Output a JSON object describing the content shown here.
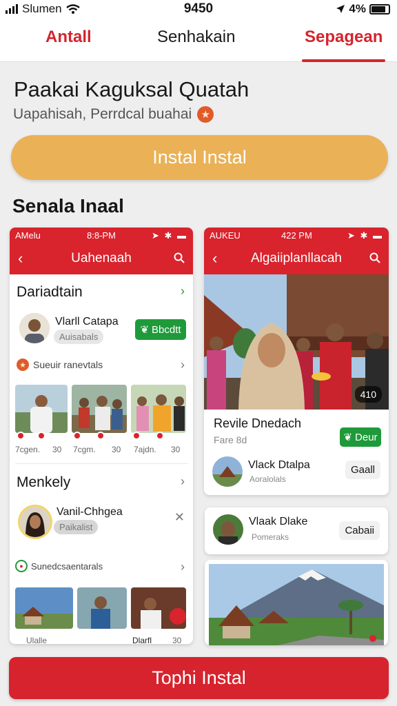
{
  "status_bar": {
    "carrier": "Slumen",
    "time": "9450",
    "battery_pct": "4%"
  },
  "top_nav": {
    "tabs": [
      {
        "label": "Antall"
      },
      {
        "label": "Senhakain"
      },
      {
        "label": "Sepagean"
      }
    ]
  },
  "hero": {
    "title": "Paakai Kaguksal Quatah",
    "subtitle": "Uapahisah, Perrdcal buahai"
  },
  "install_top": {
    "label": "Instal Instal"
  },
  "screenshots_title": "Senala Inaal",
  "left_phone": {
    "status_left": "AMelu",
    "status_time": "8:8-PM",
    "header_title": "Uahenaah",
    "section1_title": "Dariadtain",
    "profile": {
      "name": "Vlarll Catapa",
      "meta": "Auisabals",
      "button": "Bbcdtt"
    },
    "sub_row": "Sueuir ranevtals",
    "thumb_captions": [
      {
        "left": "7cgen.",
        "right": "30"
      },
      {
        "left": "7cgm.",
        "right": "30"
      },
      {
        "left": "7ajdn.",
        "right": "30"
      }
    ],
    "section2_title": "Menkely",
    "profile2": {
      "name": "Vanil-Chhgea",
      "meta": "Paikalist"
    },
    "sub_row2": "Sunedcsaentarals",
    "bottom_caption": {
      "left": "Ulalle",
      "mid": "Dlarfl",
      "right": "30"
    }
  },
  "right_phone": {
    "status_left": "AUKEU",
    "status_time": "422 PM",
    "header_title": "Algaiiplanllacah",
    "photo_badge": "410",
    "info_title": "Revile Dnedach",
    "info_sub": "Fare 8d",
    "info_button": "Deur",
    "row1": {
      "name": "Vlack Dtalpa",
      "meta": "Aoralolals",
      "action": "Gaall"
    }
  },
  "right_card2": {
    "name": "Vlaak Dlake",
    "meta": "Pomeraks",
    "action": "Cabaii"
  },
  "install_bottom": {
    "label": "Tophi Instal"
  },
  "colors": {
    "brand_red": "#d5242e",
    "install_gold": "#eab156",
    "green": "#1f9a3a"
  }
}
